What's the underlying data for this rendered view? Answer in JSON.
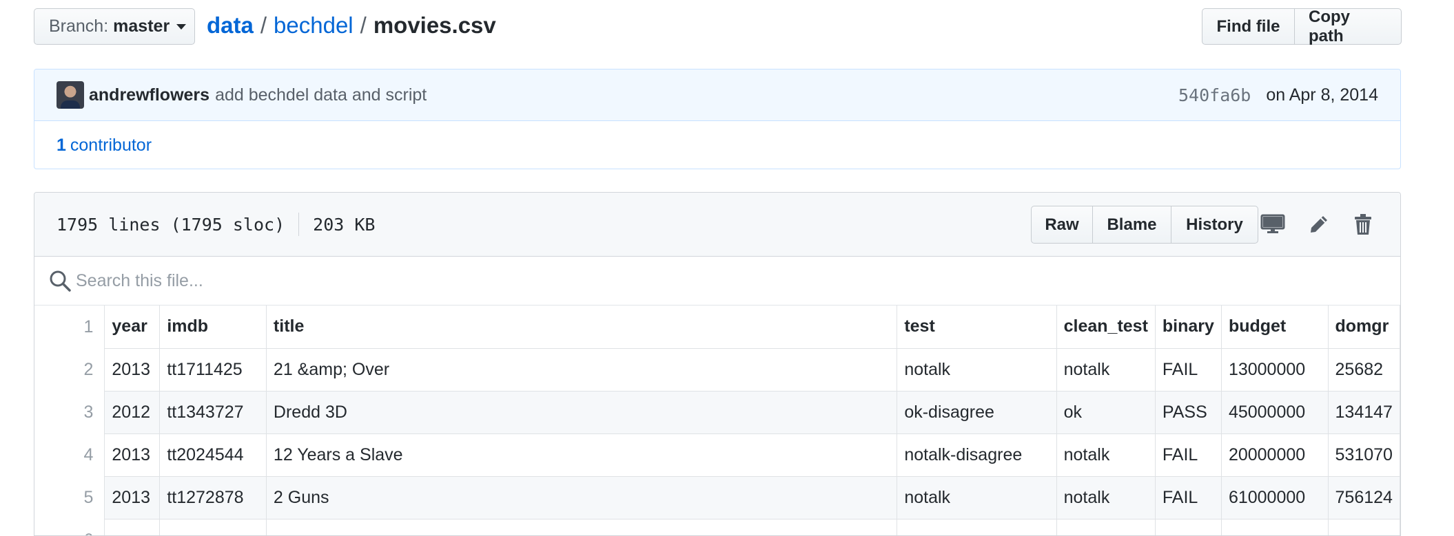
{
  "branch": {
    "prefix": "Branch:",
    "name": "master"
  },
  "breadcrumb": {
    "root": "data",
    "sep1": "/",
    "folder": "bechdel",
    "sep2": "/",
    "file": "movies.csv"
  },
  "path_actions": {
    "find_file": "Find file",
    "copy_path": "Copy path"
  },
  "commit": {
    "author": "andrewflowers",
    "message": "add bechdel data and script",
    "sha": "540fa6b",
    "date": "on Apr 8, 2014",
    "contributors_count": "1",
    "contributors_label": "contributor"
  },
  "file": {
    "lines_info": "1795 lines (1795 sloc)",
    "size": "203 KB",
    "actions": {
      "raw": "Raw",
      "blame": "Blame",
      "history": "History"
    },
    "icons": [
      "desktop-icon",
      "pencil-icon",
      "trash-icon"
    ]
  },
  "search": {
    "placeholder": "Search this file..."
  },
  "table": {
    "columns": [
      "year",
      "imdb",
      "title",
      "test",
      "clean_test",
      "binary",
      "budget",
      "domgr"
    ],
    "rows": [
      {
        "line": "1",
        "cells": [
          "year",
          "imdb",
          "title",
          "test",
          "clean_test",
          "binary",
          "budget",
          "domgr"
        ]
      },
      {
        "line": "2",
        "cells": [
          "2013",
          "tt1711425",
          "21 &amp; Over",
          "notalk",
          "notalk",
          "FAIL",
          "13000000",
          "25682"
        ]
      },
      {
        "line": "3",
        "cells": [
          "2012",
          "tt1343727",
          "Dredd 3D",
          "ok-disagree",
          "ok",
          "PASS",
          "45000000",
          "134147"
        ]
      },
      {
        "line": "4",
        "cells": [
          "2013",
          "tt2024544",
          "12 Years a Slave",
          "notalk-disagree",
          "notalk",
          "FAIL",
          "20000000",
          "531070"
        ]
      },
      {
        "line": "5",
        "cells": [
          "2013",
          "tt1272878",
          "2 Guns",
          "notalk",
          "notalk",
          "FAIL",
          "61000000",
          "756124"
        ]
      },
      {
        "line": "6",
        "cells": [
          "",
          "",
          "",
          "",
          "",
          "",
          "",
          ""
        ]
      }
    ]
  },
  "colors": {
    "link": "#0366d6",
    "commit_bg": "#f1f8ff",
    "header_bg": "#f6f8fa",
    "border": "#d1d5da"
  }
}
